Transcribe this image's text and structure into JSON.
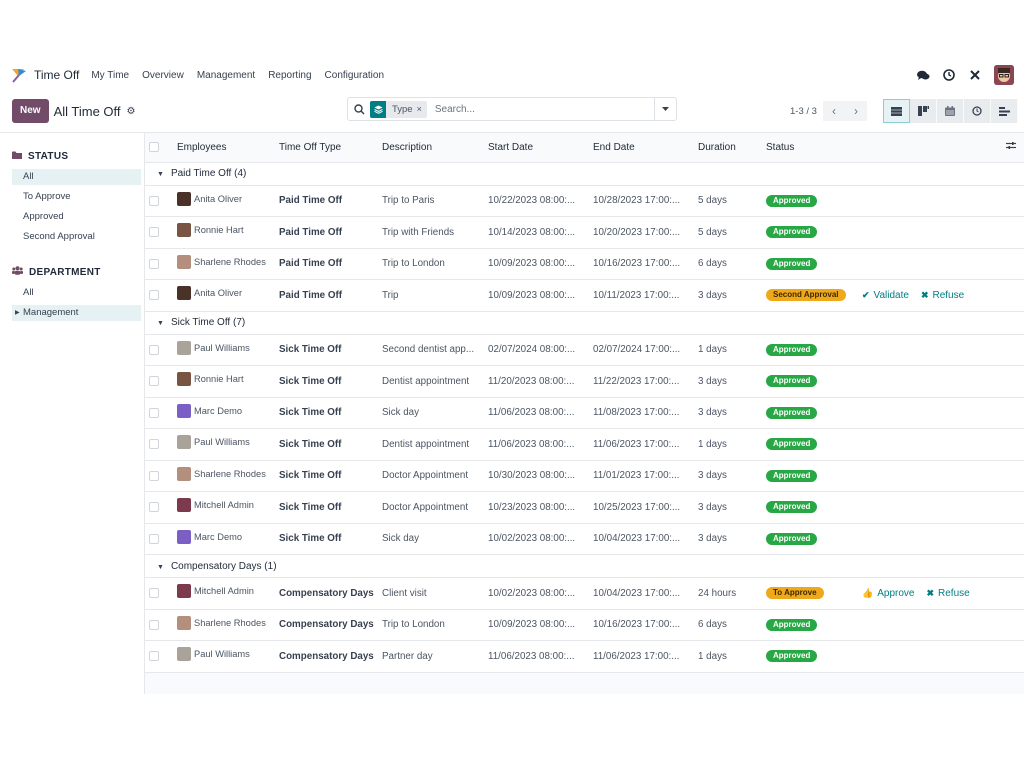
{
  "navbar": {
    "app_name": "Time Off",
    "menu": [
      "My Time",
      "Overview",
      "Management",
      "Reporting",
      "Configuration"
    ],
    "icons": [
      "chat-icon",
      "activity-clock-icon",
      "debug-tools-icon",
      "user-avatar"
    ]
  },
  "control_panel": {
    "new_label": "New",
    "title": "All Time Off",
    "search": {
      "facet_label": "Type",
      "placeholder": "Search..."
    },
    "pager": "1-3 / 3",
    "views": [
      "list",
      "kanban",
      "calendar",
      "activity",
      "gantt"
    ],
    "active_view": "list"
  },
  "sidebar": {
    "status": {
      "title": "STATUS",
      "items": [
        "All",
        "To Approve",
        "Approved",
        "Second Approval"
      ],
      "active": "All"
    },
    "department": {
      "title": "DEPARTMENT",
      "items": [
        "All",
        "Management"
      ],
      "active": "Management"
    }
  },
  "table": {
    "columns": [
      "Employees",
      "Time Off Type",
      "Description",
      "Start Date",
      "End Date",
      "Duration",
      "Status"
    ],
    "colors": {
      "approved": "#28a745",
      "pending": "#f0a81b",
      "accent": "#017e84",
      "brand": "#714b67"
    },
    "groups": [
      {
        "label": "Paid Time Off (4)",
        "rows": [
          {
            "employee": "Anita Oliver",
            "avatar": "#4a3228",
            "type": "Paid Time Off",
            "description": "Trip to Paris",
            "start": "10/22/2023 08:00:...",
            "end": "10/28/2023 17:00:...",
            "duration": "5 days",
            "status": "Approved",
            "status_kind": "approved",
            "actions": []
          },
          {
            "employee": "Ronnie Hart",
            "avatar": "#7a5442",
            "type": "Paid Time Off",
            "description": "Trip with Friends",
            "start": "10/14/2023 08:00:...",
            "end": "10/20/2023 17:00:...",
            "duration": "5 days",
            "status": "Approved",
            "status_kind": "approved",
            "actions": []
          },
          {
            "employee": "Sharlene Rhodes",
            "avatar": "#b58f7d",
            "type": "Paid Time Off",
            "description": "Trip to London",
            "start": "10/09/2023 08:00:...",
            "end": "10/16/2023 17:00:...",
            "duration": "6 days",
            "status": "Approved",
            "status_kind": "approved",
            "actions": []
          },
          {
            "employee": "Anita Oliver",
            "avatar": "#4a3228",
            "type": "Paid Time Off",
            "description": "Trip",
            "start": "10/09/2023 08:00:...",
            "end": "10/11/2023 17:00:...",
            "duration": "3 days",
            "status": "Second Approval",
            "status_kind": "pending",
            "actions": [
              {
                "icon": "check-icon",
                "glyph": "✔",
                "label": "Validate"
              },
              {
                "icon": "close-icon",
                "glyph": "✖",
                "label": "Refuse"
              }
            ]
          }
        ]
      },
      {
        "label": "Sick Time Off (7)",
        "rows": [
          {
            "employee": "Paul Williams",
            "avatar": "#a9a39a",
            "type": "Sick Time Off",
            "description": "Second dentist app...",
            "start": "02/07/2024 08:00:...",
            "end": "02/07/2024 17:00:...",
            "duration": "1 days",
            "status": "Approved",
            "status_kind": "approved",
            "actions": []
          },
          {
            "employee": "Ronnie Hart",
            "avatar": "#7a5442",
            "type": "Sick Time Off",
            "description": "Dentist appointment",
            "start": "11/20/2023 08:00:...",
            "end": "11/22/2023 17:00:...",
            "duration": "3 days",
            "status": "Approved",
            "status_kind": "approved",
            "actions": []
          },
          {
            "employee": "Marc Demo",
            "avatar": "#7b5fc4",
            "type": "Sick Time Off",
            "description": "Sick day",
            "start": "11/06/2023 08:00:...",
            "end": "11/08/2023 17:00:...",
            "duration": "3 days",
            "status": "Approved",
            "status_kind": "approved",
            "actions": []
          },
          {
            "employee": "Paul Williams",
            "avatar": "#a9a39a",
            "type": "Sick Time Off",
            "description": "Dentist appointment",
            "start": "11/06/2023 08:00:...",
            "end": "11/06/2023 17:00:...",
            "duration": "1 days",
            "status": "Approved",
            "status_kind": "approved",
            "actions": []
          },
          {
            "employee": "Sharlene Rhodes",
            "avatar": "#b58f7d",
            "type": "Sick Time Off",
            "description": "Doctor Appointment",
            "start": "10/30/2023 08:00:...",
            "end": "11/01/2023 17:00:...",
            "duration": "3 days",
            "status": "Approved",
            "status_kind": "approved",
            "actions": []
          },
          {
            "employee": "Mitchell Admin",
            "avatar": "#7d3a4c",
            "type": "Sick Time Off",
            "description": "Doctor Appointment",
            "start": "10/23/2023 08:00:...",
            "end": "10/25/2023 17:00:...",
            "duration": "3 days",
            "status": "Approved",
            "status_kind": "approved",
            "actions": []
          },
          {
            "employee": "Marc Demo",
            "avatar": "#7b5fc4",
            "type": "Sick Time Off",
            "description": "Sick day",
            "start": "10/02/2023 08:00:...",
            "end": "10/04/2023 17:00:...",
            "duration": "3 days",
            "status": "Approved",
            "status_kind": "approved",
            "actions": []
          }
        ]
      },
      {
        "label": "Compensatory Days (1)",
        "rows": [
          {
            "employee": "Mitchell Admin",
            "avatar": "#7d3a4c",
            "type": "Compensatory Days",
            "description": "Client visit",
            "start": "10/02/2023 08:00:...",
            "end": "10/04/2023 17:00:...",
            "duration": "24 hours",
            "status": "To Approve",
            "status_kind": "pending",
            "actions": [
              {
                "icon": "thumbs-up-icon",
                "glyph": "👍",
                "label": "Approve"
              },
              {
                "icon": "close-icon",
                "glyph": "✖",
                "label": "Refuse"
              }
            ]
          },
          {
            "employee": "Sharlene Rhodes",
            "avatar": "#b58f7d",
            "type": "Compensatory Days",
            "description": "Trip to London",
            "start": "10/09/2023 08:00:...",
            "end": "10/16/2023 17:00:...",
            "duration": "6 days",
            "status": "Approved",
            "status_kind": "approved",
            "actions": []
          },
          {
            "employee": "Paul Williams",
            "avatar": "#a9a39a",
            "type": "Compensatory Days",
            "description": "Partner day",
            "start": "11/06/2023 08:00:...",
            "end": "11/06/2023 17:00:...",
            "duration": "1 days",
            "status": "Approved",
            "status_kind": "approved",
            "actions": []
          }
        ]
      }
    ]
  }
}
